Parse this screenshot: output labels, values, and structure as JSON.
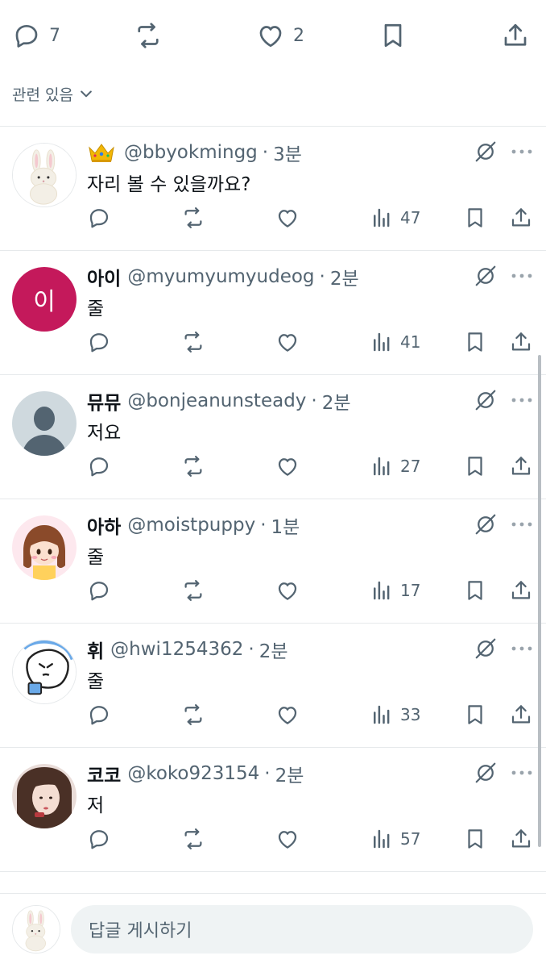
{
  "top_actions": {
    "reply_count": "7",
    "like_count": "2"
  },
  "sort_label": "관련 있음",
  "replies": [
    {
      "name": "",
      "handle": "@bbyokmingg",
      "separator": "·",
      "time": "3분",
      "text": "자리 볼 수 있을까요?",
      "views": "47",
      "avatar": "bunny"
    },
    {
      "name": "아이",
      "handle": "@myumyumyudeog",
      "separator": "·",
      "time": "2분",
      "text": "줄",
      "views": "41",
      "avatar": "letter",
      "avatar_letter": "이",
      "avatar_color": "#c4195b"
    },
    {
      "name": "뮤뮤",
      "handle": "@bonjeanunsteady",
      "separator": "·",
      "time": "2분",
      "text": "저요",
      "views": "27",
      "avatar": "default-person"
    },
    {
      "name": "아하",
      "handle": "@moistpuppy",
      "separator": "·",
      "time": "1분",
      "text": "줄",
      "views": "17",
      "avatar": "girl-illustration"
    },
    {
      "name": "휘",
      "handle": "@hwi1254362",
      "separator": "·",
      "time": "2분",
      "text": "줄",
      "views": "33",
      "avatar": "doodle-cat"
    },
    {
      "name": "코코",
      "handle": "@koko923154",
      "separator": "·",
      "time": "2분",
      "text": "저",
      "views": "57",
      "avatar": "photo"
    }
  ],
  "compose": {
    "placeholder": "답글 게시하기",
    "avatar": "bunny"
  },
  "colors": {
    "text": "#0f1419",
    "secondary": "#536471",
    "divider": "#e6e9eb",
    "input_bg": "#eff3f4"
  },
  "icons": [
    "reply-icon",
    "retweet-icon",
    "like-icon",
    "bookmark-icon",
    "share-icon",
    "views-icon",
    "no-follow-icon",
    "more-icon",
    "crown-icon",
    "chevron-down-icon"
  ]
}
